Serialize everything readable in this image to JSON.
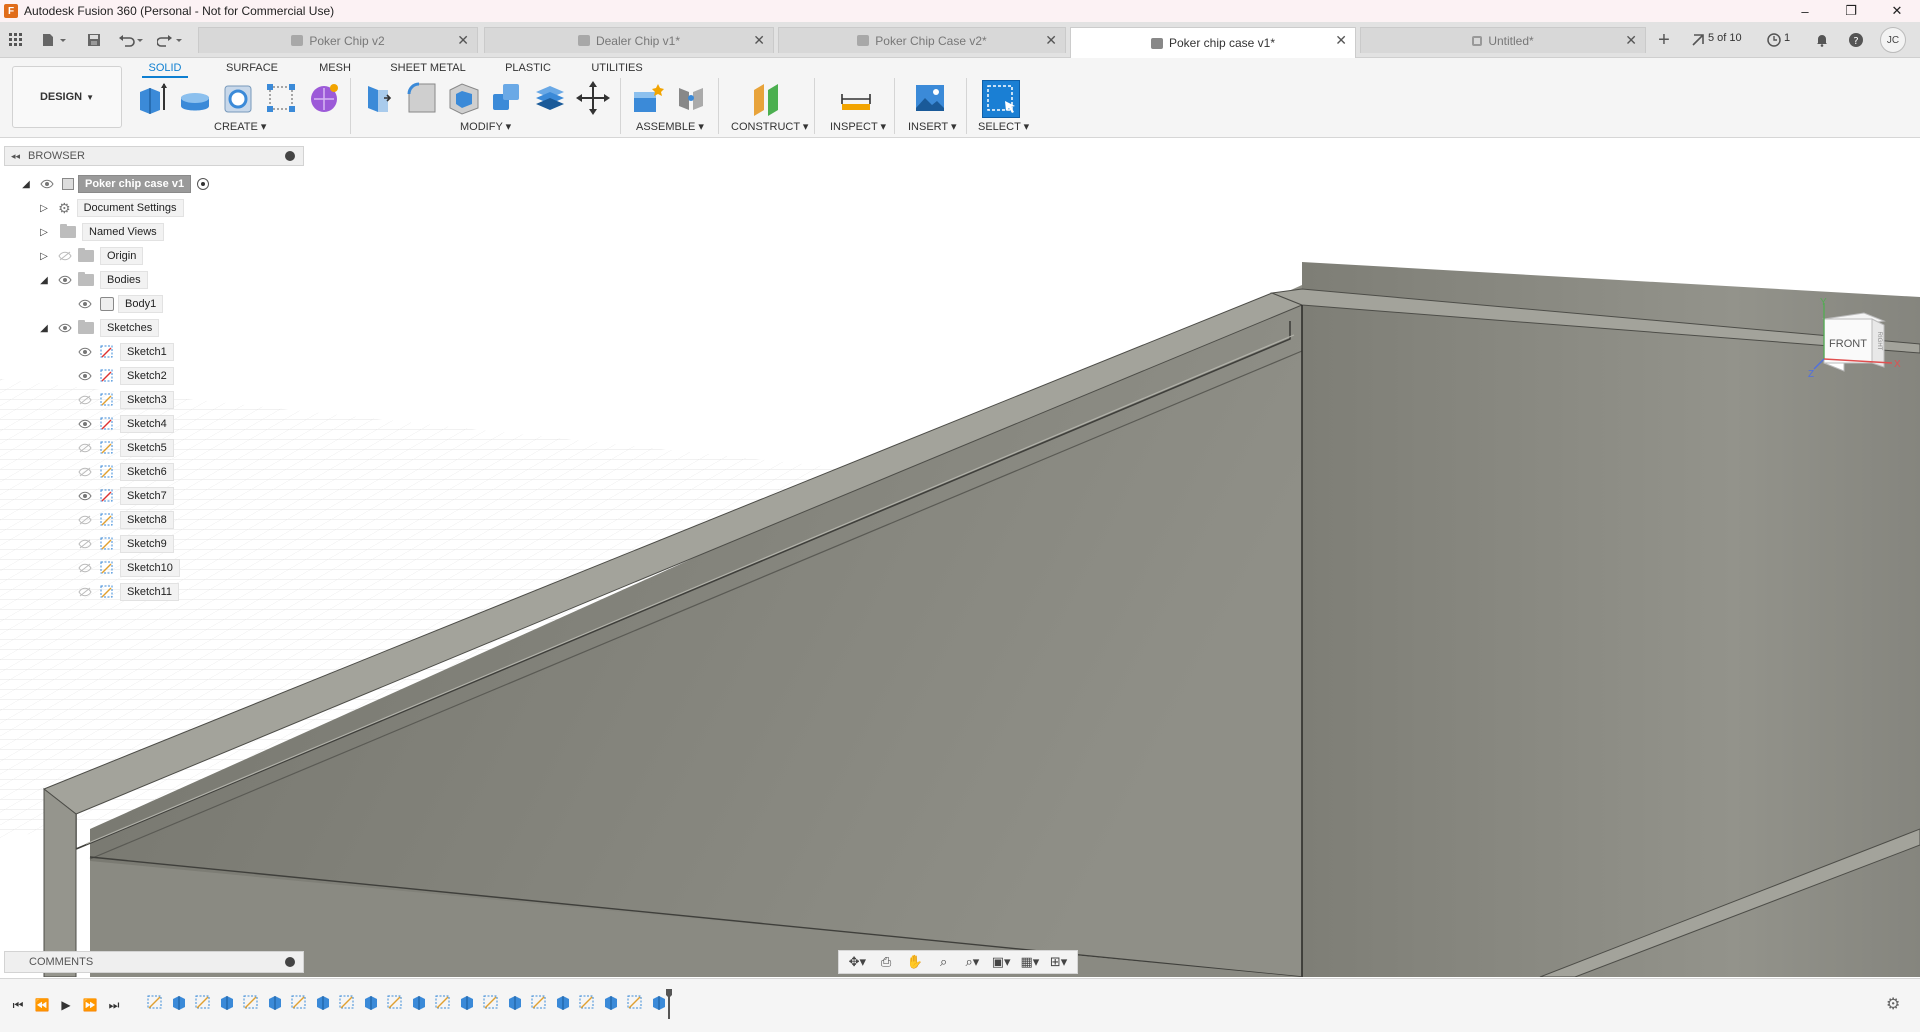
{
  "window": {
    "title": "Autodesk Fusion 360 (Personal - Not for Commercial Use)",
    "controls": [
      "–",
      "❐",
      "✕"
    ]
  },
  "tabs": [
    {
      "label": "Poker Chip v2",
      "active": false
    },
    {
      "label": "Dealer Chip v1*",
      "active": false
    },
    {
      "label": "Poker Chip Case v2*",
      "active": false
    },
    {
      "label": "Poker chip case v1*",
      "active": true
    },
    {
      "label": "Untitled*",
      "active": false
    }
  ],
  "tab_counter": "5 of 10",
  "job_status_count": "1",
  "user_initials": "JC",
  "toolbar": {
    "workspace": "DESIGN",
    "workspace_tabs": [
      "SOLID",
      "SURFACE",
      "MESH",
      "SHEET METAL",
      "PLASTIC",
      "UTILITIES"
    ],
    "active_workspace_tab": "SOLID",
    "groups": {
      "create": "CREATE",
      "modify": "MODIFY",
      "assemble": "ASSEMBLE",
      "construct": "CONSTRUCT",
      "inspect": "INSPECT",
      "insert": "INSERT",
      "select": "SELECT"
    }
  },
  "browser": {
    "title": "BROWSER",
    "root": "Poker chip case v1",
    "items": [
      {
        "label": "Document Settings",
        "type": "settings"
      },
      {
        "label": "Named Views",
        "type": "folder"
      },
      {
        "label": "Origin",
        "type": "folder"
      },
      {
        "label": "Bodies",
        "type": "folder"
      },
      {
        "label": "Body1",
        "type": "body"
      },
      {
        "label": "Sketches",
        "type": "folder"
      }
    ],
    "sketches": [
      {
        "label": "Sketch1",
        "visible": true
      },
      {
        "label": "Sketch2",
        "visible": true
      },
      {
        "label": "Sketch3",
        "visible": false
      },
      {
        "label": "Sketch4",
        "visible": true
      },
      {
        "label": "Sketch5",
        "visible": false
      },
      {
        "label": "Sketch6",
        "visible": false
      },
      {
        "label": "Sketch7",
        "visible": true
      },
      {
        "label": "Sketch8",
        "visible": false
      },
      {
        "label": "Sketch9",
        "visible": false
      },
      {
        "label": "Sketch10",
        "visible": false
      },
      {
        "label": "Sketch11",
        "visible": false
      }
    ]
  },
  "comments": {
    "title": "COMMENTS"
  },
  "viewcube": {
    "face": "FRONT",
    "right_face": "RIGHT",
    "axis_x": "X",
    "axis_y": "Y",
    "axis_z": "Z"
  },
  "colors": {
    "accent": "#0e7fd1",
    "body": "#8c8c84",
    "body_dark": "#6e6e67",
    "body_light": "#a6a69e"
  }
}
